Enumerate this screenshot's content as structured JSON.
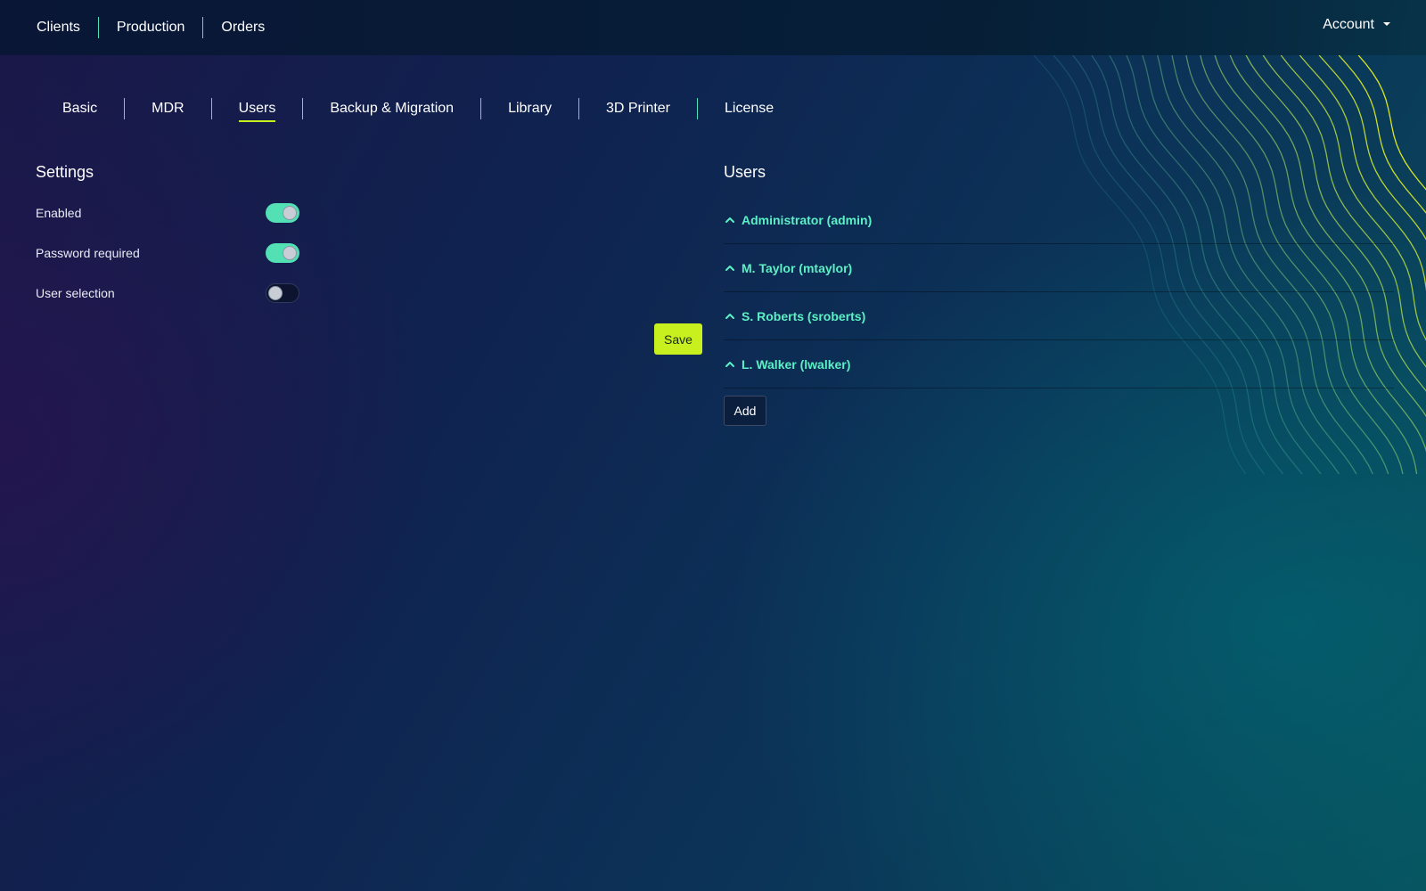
{
  "topnav": {
    "items": [
      {
        "label": "Clients"
      },
      {
        "label": "Production"
      },
      {
        "label": "Orders"
      }
    ],
    "account_label": "Account"
  },
  "tabs": [
    {
      "label": "Basic",
      "active": false
    },
    {
      "label": "MDR",
      "active": false
    },
    {
      "label": "Users",
      "active": true
    },
    {
      "label": "Backup & Migration",
      "active": false
    },
    {
      "label": "Library",
      "active": false
    },
    {
      "label": "3D Printer",
      "active": false
    },
    {
      "label": "License",
      "active": false
    }
  ],
  "settings": {
    "title": "Settings",
    "rows": [
      {
        "label": "Enabled",
        "on": true
      },
      {
        "label": "Password required",
        "on": true
      },
      {
        "label": "User selection",
        "on": false
      }
    ],
    "save_label": "Save"
  },
  "users": {
    "title": "Users",
    "items": [
      {
        "name": "Administrator (admin)"
      },
      {
        "name": "M. Taylor (mtaylor)"
      },
      {
        "name": "S. Roberts (sroberts)"
      },
      {
        "name": "L. Walker (lwalker)"
      }
    ],
    "add_label": "Add"
  },
  "colors": {
    "accent_green": "#5cf0c4",
    "save_yellow": "#c8f01e",
    "toggle_on": "#52e0b4"
  },
  "icons": {
    "account_caret": "caret-down-icon",
    "user_expand": "chevron-up-icon"
  }
}
